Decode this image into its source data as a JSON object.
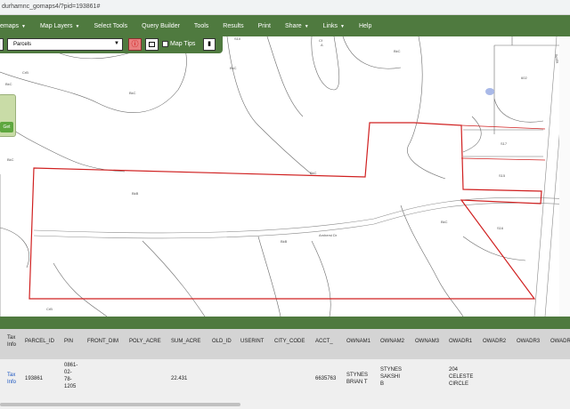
{
  "browser": {
    "url": "durhamnc_gomaps4/?pid=193861#"
  },
  "menu": {
    "items": [
      {
        "label": "emaps",
        "dropdown": true
      },
      {
        "label": "Map Layers",
        "dropdown": true
      },
      {
        "label": "Select Tools",
        "dropdown": false
      },
      {
        "label": "Query Builder",
        "dropdown": false
      },
      {
        "label": "Tools",
        "dropdown": false
      },
      {
        "label": "Results",
        "dropdown": false
      },
      {
        "label": "Print",
        "dropdown": false
      },
      {
        "label": "Share",
        "dropdown": true
      },
      {
        "label": "Links",
        "dropdown": true
      },
      {
        "label": "Help",
        "dropdown": false
      }
    ]
  },
  "toolbar": {
    "layer_selected": "Parcels",
    "info_icon": "info-circle-icon",
    "map_tips_label": "Map Tips",
    "clipboard_icon": "clipboard-icon"
  },
  "float_panel": {
    "go_label": "Get"
  },
  "map": {
    "road_label": "Amherst Dr",
    "side_road_label": "Serita",
    "soil_labels": [
      "CrB",
      "BkC",
      "BkC",
      "BkB",
      "BkC",
      "BkC",
      "CrB",
      "BkC",
      "BkC",
      "BkB",
      "BkC",
      "S10",
      "Cf",
      "A",
      "S17",
      "S15",
      "S16",
      "602",
      "WeC"
    ]
  },
  "table": {
    "headers": [
      "Tax\nInfo",
      "PARCEL_ID",
      "PIN",
      "FRONT_DIM",
      "POLY_ACRE",
      "SUM_ACRE",
      "OLD_ID",
      "USERINT",
      "CITY_CODE",
      "ACCT_",
      "OWNAM1",
      "OWNAM2",
      "OWNAM3",
      "OWADR1",
      "OWADR2",
      "OWADR3",
      "OWADR"
    ],
    "rows": [
      {
        "tax_info": "Tax\nInfo",
        "parcel_id": "193861",
        "pin": "0861-\n02-\n78-\n1205",
        "front_dim": "",
        "poly_acre": "",
        "sum_acre": "22.431",
        "old_id": "",
        "userint": "",
        "city_code": "",
        "acct": "6635763",
        "ownam1": "STYNES\nBRIAN T",
        "ownam2": "STYNES\nSAKSHI\nB",
        "ownam3": "",
        "owadr1": "204\nCELESTE\nCIRCLE",
        "owadr2": "",
        "owadr3": "",
        "owadr": ""
      }
    ]
  },
  "colors": {
    "header_green": "#4f7a3f",
    "parcel_outline": "#d02020",
    "link_blue": "#1a55c0"
  }
}
